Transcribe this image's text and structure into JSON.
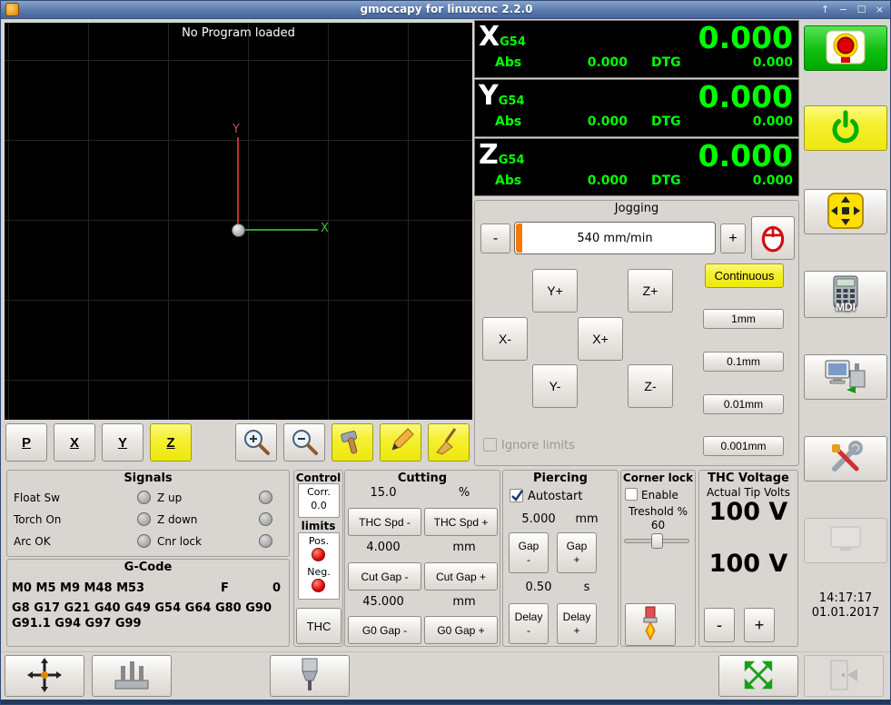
{
  "titlebar": {
    "title": "gmoccapy for linuxcnc  2.2.0",
    "icons": {
      "ontop": "↑",
      "minimize": "−",
      "maximize": "☐",
      "close": "×"
    }
  },
  "preview": {
    "message": "No Program loaded",
    "x_axis_label": "X",
    "y_axis_label": "Y"
  },
  "preview_toolbar": {
    "letters": [
      "P",
      "X",
      "Y",
      "Z"
    ]
  },
  "dro": {
    "axes": [
      {
        "letter": "X",
        "system": "G54",
        "value": "0.000",
        "abs_label": "Abs",
        "abs_value": "0.000",
        "dtg_label": "DTG",
        "dtg_value": "0.000"
      },
      {
        "letter": "Y",
        "system": "G54",
        "value": "0.000",
        "abs_label": "Abs",
        "abs_value": "0.000",
        "dtg_label": "DTG",
        "dtg_value": "0.000"
      },
      {
        "letter": "Z",
        "system": "G54",
        "value": "0.000",
        "abs_label": "Abs",
        "abs_value": "0.000",
        "dtg_label": "DTG",
        "dtg_value": "0.000"
      }
    ]
  },
  "jogging": {
    "title": "Jogging",
    "slower_label": "-",
    "faster_label": "+",
    "feed_display": "540 mm/min",
    "continuous_label": "Continuous",
    "jog_buttons": [
      "Y+",
      "Z+",
      "X-",
      "X+",
      "Y-",
      "Z-"
    ],
    "increments": [
      "1mm",
      "0.1mm",
      "0.01mm",
      "0.001mm"
    ],
    "ignore_limits_label": "Ignore limits"
  },
  "right_panel": {
    "mdi_label": "MDI",
    "time": "14:17:17",
    "date": "01.01.2017"
  },
  "signals": {
    "title": "Signals",
    "left": [
      "Float Sw",
      "Torch On",
      "Arc OK"
    ],
    "right": [
      "Z up",
      "Z down",
      "Cnr lock"
    ]
  },
  "gcode": {
    "title": "G-Code",
    "active_m_codes": "M0 M5 M9 M48 M53",
    "feed_label": "F",
    "feed_value": "0",
    "active_g_codes": "G8 G17 G21 G40 G49 G54 G64 G80 G90 G91.1 G94 G97 G99"
  },
  "control": {
    "title": "Control",
    "corr_label": "Corr.",
    "corr_value": "0.0",
    "limits_title": "limits",
    "pos_label": "Pos.",
    "neg_label": "Neg.",
    "thc_label": "THC"
  },
  "cutting": {
    "title": "Cutting",
    "rows": [
      {
        "value": "15.0",
        "unit": "%",
        "minus": "THC Spd -",
        "plus": "THC Spd +"
      },
      {
        "value": "4.000",
        "unit": "mm",
        "minus": "Cut Gap -",
        "plus": "Cut Gap +"
      },
      {
        "value": "45.000",
        "unit": "mm",
        "minus": "G0 Gap -",
        "plus": "G0 Gap +"
      }
    ]
  },
  "piercing": {
    "title": "Piercing",
    "autostart_label": "Autostart",
    "height_value": "5.000",
    "height_unit": "mm",
    "gap_label": "Gap",
    "delay_label": "Delay",
    "minus": "-",
    "plus": "+",
    "delay_value": "0.50",
    "delay_unit": "s"
  },
  "corner_lock": {
    "title": "Corner lock",
    "enable_label": "Enable",
    "threshold_label": "Treshold %",
    "threshold_value": "60"
  },
  "thc": {
    "title": "THC Voltage",
    "subtitle": "Actual Tip Volts",
    "actual_volts": "100 V",
    "target_volts": "100 V",
    "minus": "-",
    "plus": "+"
  }
}
